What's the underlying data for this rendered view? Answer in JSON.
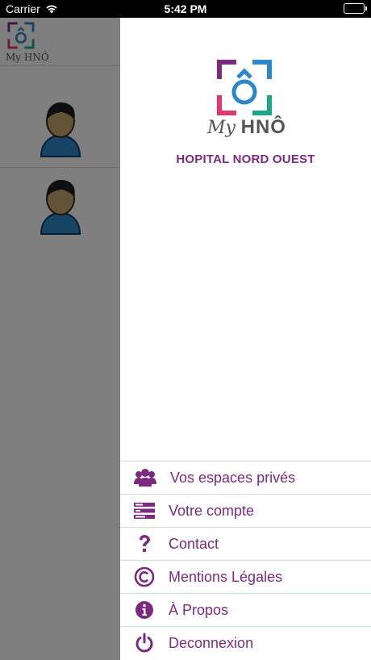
{
  "status_bar": {
    "carrier": "Carrier",
    "time": "5:42 PM"
  },
  "app": {
    "small_logo_text": "My HNÔ",
    "users": [
      {
        "avatar": "user-avatar-icon"
      },
      {
        "avatar": "user-avatar-icon"
      }
    ]
  },
  "drawer": {
    "logo_my": "My",
    "logo_hno": "HNÔ",
    "hospital_name": "HOPITAL NORD OUEST",
    "menu": [
      {
        "label": "Vos espaces privés",
        "icon": "group-icon"
      },
      {
        "label": "Votre compte",
        "icon": "account-icon"
      },
      {
        "label": "Contact",
        "icon": "question-icon"
      },
      {
        "label": "Mentions Légales",
        "icon": "copyright-icon"
      },
      {
        "label": "À Propos",
        "icon": "info-icon"
      },
      {
        "label": "Deconnexion",
        "icon": "power-icon"
      }
    ]
  },
  "colors": {
    "accent": "#7b2a80",
    "divider": "#c6e3d4",
    "logo_purple": "#7b2a80",
    "logo_pink": "#e2396d",
    "logo_teal": "#1ba88a",
    "logo_blue": "#2f86c8"
  }
}
